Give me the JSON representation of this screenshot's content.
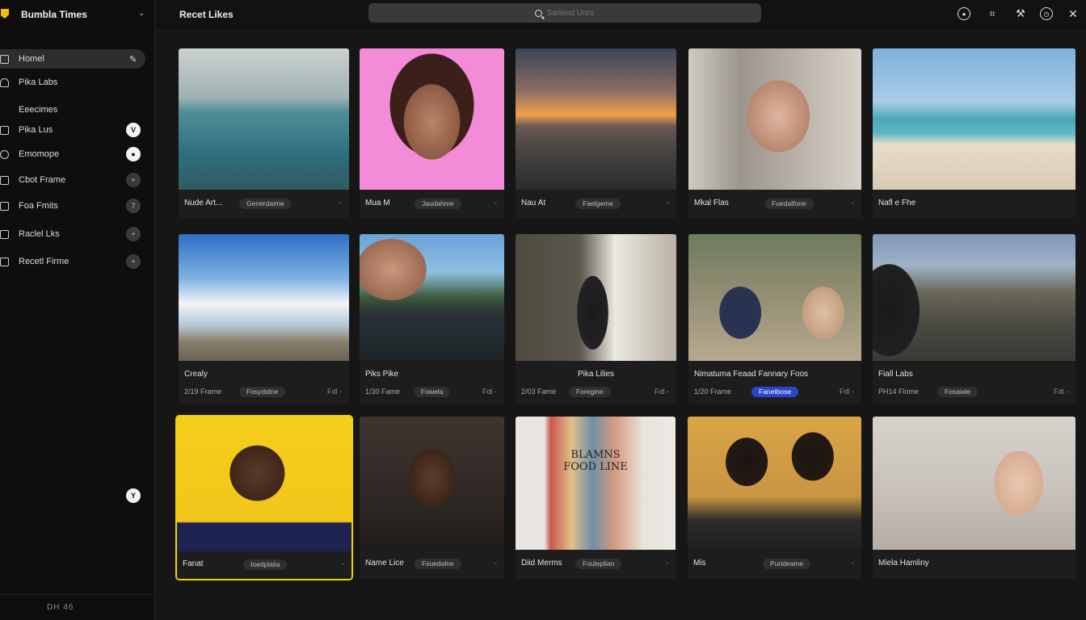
{
  "app": {
    "title": "Bumbla Times"
  },
  "sidebar": {
    "items": [
      {
        "label": "Homel",
        "icon": "home-icon",
        "active": true
      },
      {
        "label": "Pika Labs",
        "icon": "person-icon"
      },
      {
        "label": "Eeecimes",
        "icon": ""
      },
      {
        "label": "Pika Lus",
        "icon": "grid-icon",
        "badge": "V"
      },
      {
        "label": "Emomope",
        "icon": "clock-icon",
        "badge": "●"
      },
      {
        "label": "Cbot Frame",
        "icon": "chat-icon",
        "badge": "+"
      },
      {
        "label": "Foa Fmits",
        "icon": "box-icon",
        "badge": "7"
      },
      {
        "label": "Raclel Lks",
        "icon": "heart-icon",
        "badge": "+"
      },
      {
        "label": "Recetl Firme",
        "icon": "list-icon",
        "badge": "+"
      }
    ],
    "bottom_badge": "Y",
    "footer": "DH 46"
  },
  "header": {
    "title": "Recet Likes",
    "search": {
      "placeholder": "Sarlend Unrs"
    }
  },
  "grid": {
    "row1": [
      {
        "title": "Nude Art...",
        "tag": "Generdaime",
        "more": "-"
      },
      {
        "title": "Mua M",
        "tag": "Jaudahme",
        "more": "-"
      },
      {
        "title": "Nau At",
        "tag": "Faelgeme",
        "more": "-"
      },
      {
        "title": "Mkal Flas",
        "tag": "Fuedalfone",
        "more": "-"
      },
      {
        "title": "Nafl e Fhe",
        "tag": "",
        "more": ""
      }
    ],
    "row2": [
      {
        "title": "Crealy",
        "sub": "2/19 Frame",
        "tag": "Fosydidne",
        "more": "Fdl -"
      },
      {
        "title": "Piks Pike",
        "sub": "1/30 Fame",
        "tag": "Fowela",
        "more": "Fdl -"
      },
      {
        "title": "Pika Lilies",
        "sub": "2/03 Fame",
        "tag": "Foregine",
        "more": "Fdl -"
      },
      {
        "title": "Nimatuma Feaad Fannary Foos",
        "sub": "1/20 Frame",
        "tag": "Fanetbose",
        "more": "Fdl -",
        "highlight": true
      },
      {
        "title": "Fiall Labs",
        "sub": "PH14 Flome",
        "tag": "Fosaiale",
        "more": "Fdl -"
      }
    ],
    "row3": [
      {
        "title": "Fanat",
        "tag": "Ioedplalia",
        "more": "-"
      },
      {
        "title": "Name Lice",
        "tag": "Fsuedalne",
        "more": "-"
      },
      {
        "title": "Diid Merms",
        "tag": "Fouleplian",
        "more": "-"
      },
      {
        "title": "Mis",
        "tag": "Purideame",
        "more": "-"
      },
      {
        "title": "Miela Hamliny",
        "tag": "",
        "more": ""
      }
    ],
    "board_caption": "BLAMNS FOOD LINE"
  }
}
